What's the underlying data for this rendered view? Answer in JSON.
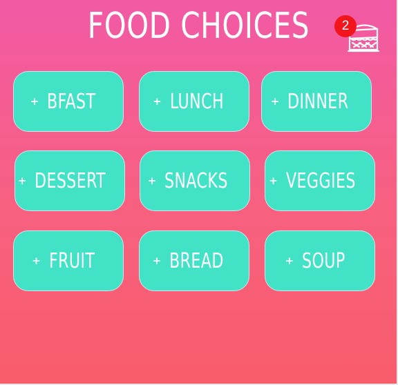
{
  "header": {
    "title": "FOOD CHOICES"
  },
  "tray": {
    "icon": "sandwich-tray-icon",
    "badge_count": "2",
    "badge_color": "#f2151c"
  },
  "colors": {
    "background_top": "#f25aa5",
    "background_bottom": "#f95d6b",
    "tile": "#42e2c7",
    "text": "#ffffff"
  },
  "tile_prefix": "+",
  "tiles": [
    {
      "label": "BFAST"
    },
    {
      "label": "LUNCH"
    },
    {
      "label": "DINNER"
    },
    {
      "label": "DESSERT"
    },
    {
      "label": "SNACKS"
    },
    {
      "label": "VEGGIES"
    },
    {
      "label": "FRUIT"
    },
    {
      "label": "BREAD"
    },
    {
      "label": "SOUP"
    }
  ]
}
